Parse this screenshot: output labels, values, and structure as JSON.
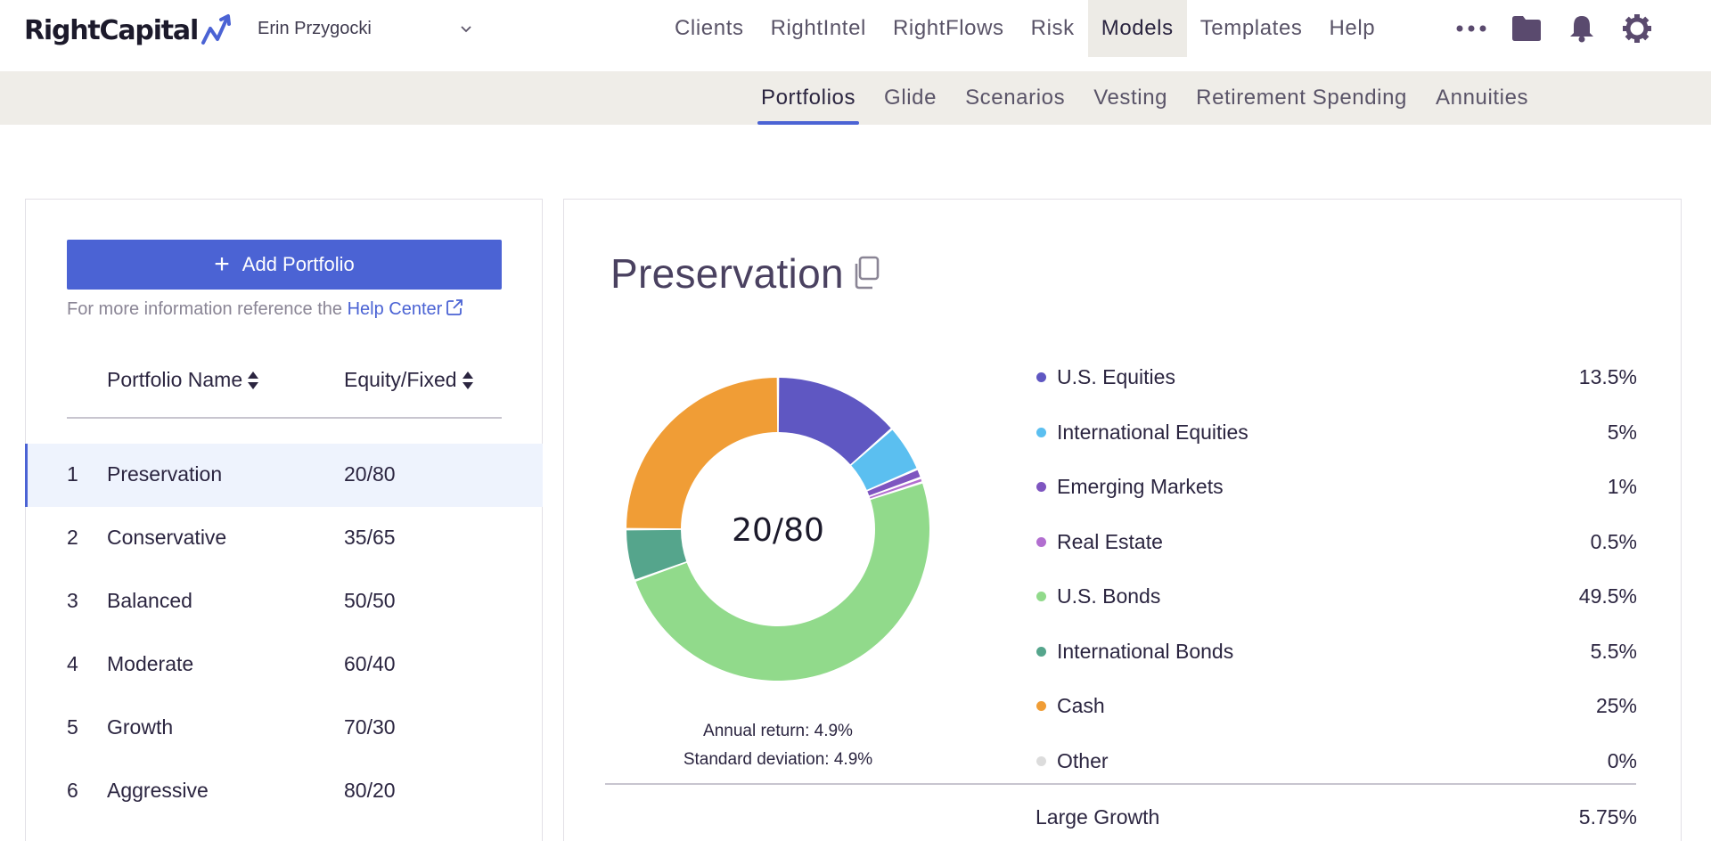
{
  "header": {
    "logo_text": "RightCapital",
    "client_name": "Erin Przygocki",
    "nav": [
      "Clients",
      "RightIntel",
      "RightFlows",
      "Risk",
      "Models",
      "Templates",
      "Help"
    ],
    "active_nav": "Models",
    "icons": [
      "more-icon",
      "folder-icon",
      "bell-icon",
      "gear-icon"
    ]
  },
  "subnav": {
    "items": [
      "Portfolios",
      "Glide",
      "Scenarios",
      "Vesting",
      "Retirement Spending",
      "Annuities"
    ],
    "active": "Portfolios"
  },
  "sidebar": {
    "add_label": "Add Portfolio",
    "help_prefix": "For more information reference the",
    "help_link": "Help Center",
    "col_name": "Portfolio Name",
    "col_eq": "Equity/Fixed",
    "rows": [
      {
        "num": "1",
        "name": "Preservation",
        "eq": "20/80",
        "selected": true
      },
      {
        "num": "2",
        "name": "Conservative",
        "eq": "35/65"
      },
      {
        "num": "3",
        "name": "Balanced",
        "eq": "50/50"
      },
      {
        "num": "4",
        "name": "Moderate",
        "eq": "60/40"
      },
      {
        "num": "5",
        "name": "Growth",
        "eq": "70/30"
      },
      {
        "num": "6",
        "name": "Aggressive",
        "eq": "80/20"
      }
    ]
  },
  "detail": {
    "title": "Preservation",
    "annual_return": "Annual return: 4.9%",
    "std_dev": "Standard deviation: 4.9%",
    "sub_class": {
      "name": "Large Growth",
      "value": "5.75%"
    }
  },
  "chart_data": {
    "type": "pie",
    "center_label": "20/80",
    "categories": [
      "U.S. Equities",
      "International Equities",
      "Emerging Markets",
      "Real Estate",
      "U.S. Bonds",
      "International Bonds",
      "Cash",
      "Other"
    ],
    "values": [
      13.5,
      5,
      1,
      0.5,
      49.5,
      5.5,
      25,
      0
    ],
    "labels": [
      "13.5%",
      "5%",
      "1%",
      "0.5%",
      "49.5%",
      "5.5%",
      "25%",
      "0%"
    ],
    "colors": [
      "#5f57c2",
      "#5bbff0",
      "#7e55c0",
      "#b26ed0",
      "#91da8b",
      "#55a58c",
      "#f09d36",
      "#dcdcdc"
    ]
  }
}
